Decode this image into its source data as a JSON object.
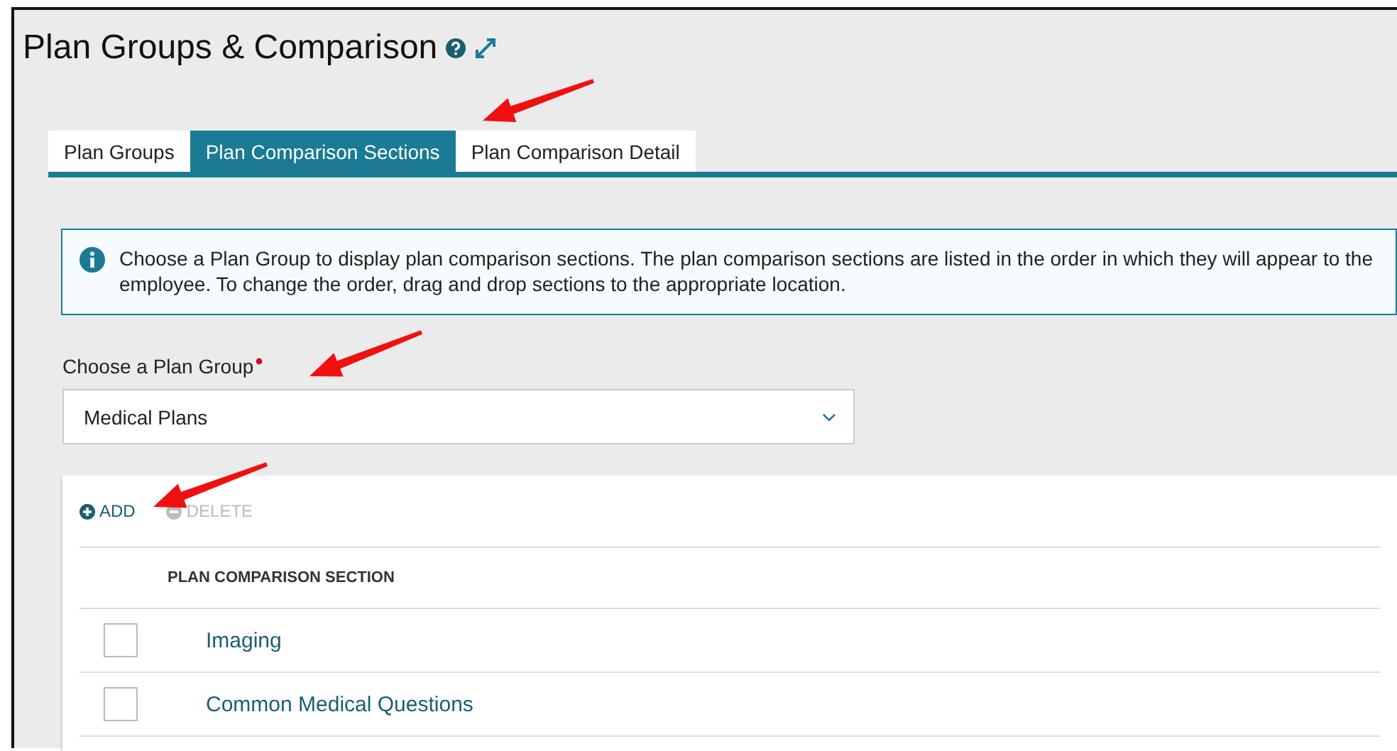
{
  "page": {
    "title": "Plan Groups & Comparison"
  },
  "tabs": [
    {
      "label": "Plan Groups",
      "selected": false
    },
    {
      "label": "Plan Comparison Sections",
      "selected": true
    },
    {
      "label": "Plan Comparison Detail",
      "selected": false
    }
  ],
  "info": {
    "text": "Choose a Plan Group to display plan comparison sections. The plan comparison sections are listed in the order in which they will appear to the employee. To change the order, drag and drop sections to the appropriate location."
  },
  "plan_group": {
    "label": "Choose a Plan Group",
    "required": true,
    "value": "Medical Plans"
  },
  "toolbar": [
    {
      "label": "ADD",
      "kind": "add",
      "disabled": false
    },
    {
      "label": "DELETE",
      "kind": "delete",
      "disabled": true
    }
  ],
  "table": {
    "columns": [
      "PLAN COMPARISON SECTION"
    ],
    "rows": [
      {
        "name": "Imaging",
        "checked": false
      },
      {
        "name": "Common Medical Questions",
        "checked": false
      }
    ]
  }
}
